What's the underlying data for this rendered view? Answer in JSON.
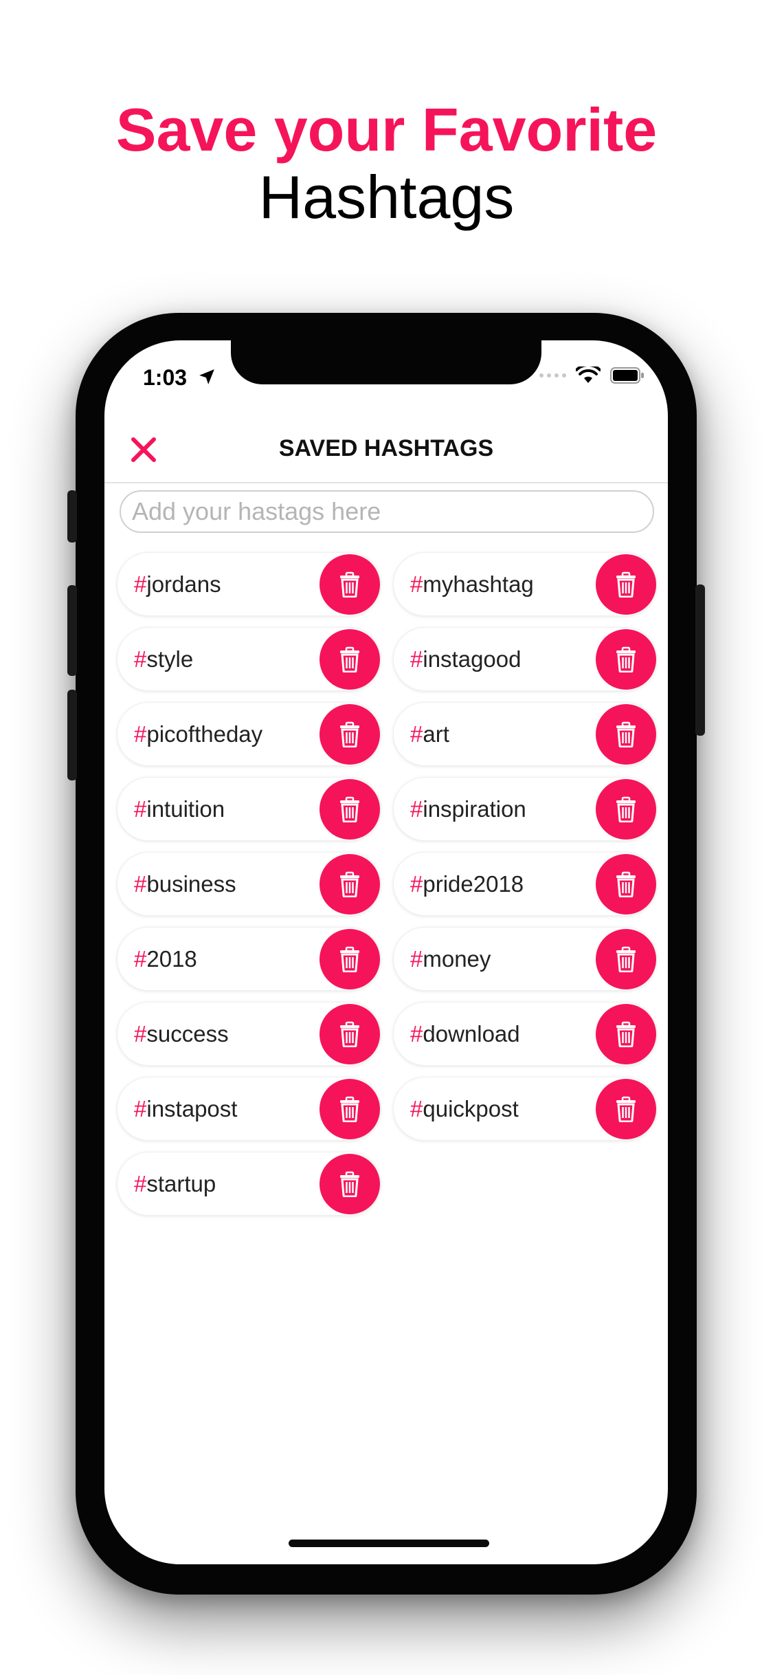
{
  "headline": {
    "accent": "Save your Favorite",
    "main": "Hashtags"
  },
  "status_bar": {
    "time": "1:03"
  },
  "nav": {
    "title": "SAVED HASHTAGS",
    "close_icon": "close-x-icon"
  },
  "search": {
    "placeholder": "Add your hastags here",
    "value": ""
  },
  "tags": [
    {
      "name": "jordans"
    },
    {
      "name": "myhashtag"
    },
    {
      "name": "style"
    },
    {
      "name": "instagood"
    },
    {
      "name": "picoftheday"
    },
    {
      "name": "art"
    },
    {
      "name": "intuition"
    },
    {
      "name": "inspiration"
    },
    {
      "name": "business"
    },
    {
      "name": "pride2018"
    },
    {
      "name": "2018"
    },
    {
      "name": "money"
    },
    {
      "name": "success"
    },
    {
      "name": "download"
    },
    {
      "name": "instapost"
    },
    {
      "name": "quickpost"
    },
    {
      "name": "startup"
    }
  ],
  "tag_prefix": "#",
  "delete_icon": "trash-icon",
  "colors": {
    "accent": "#f5145a",
    "text": "#222222"
  }
}
